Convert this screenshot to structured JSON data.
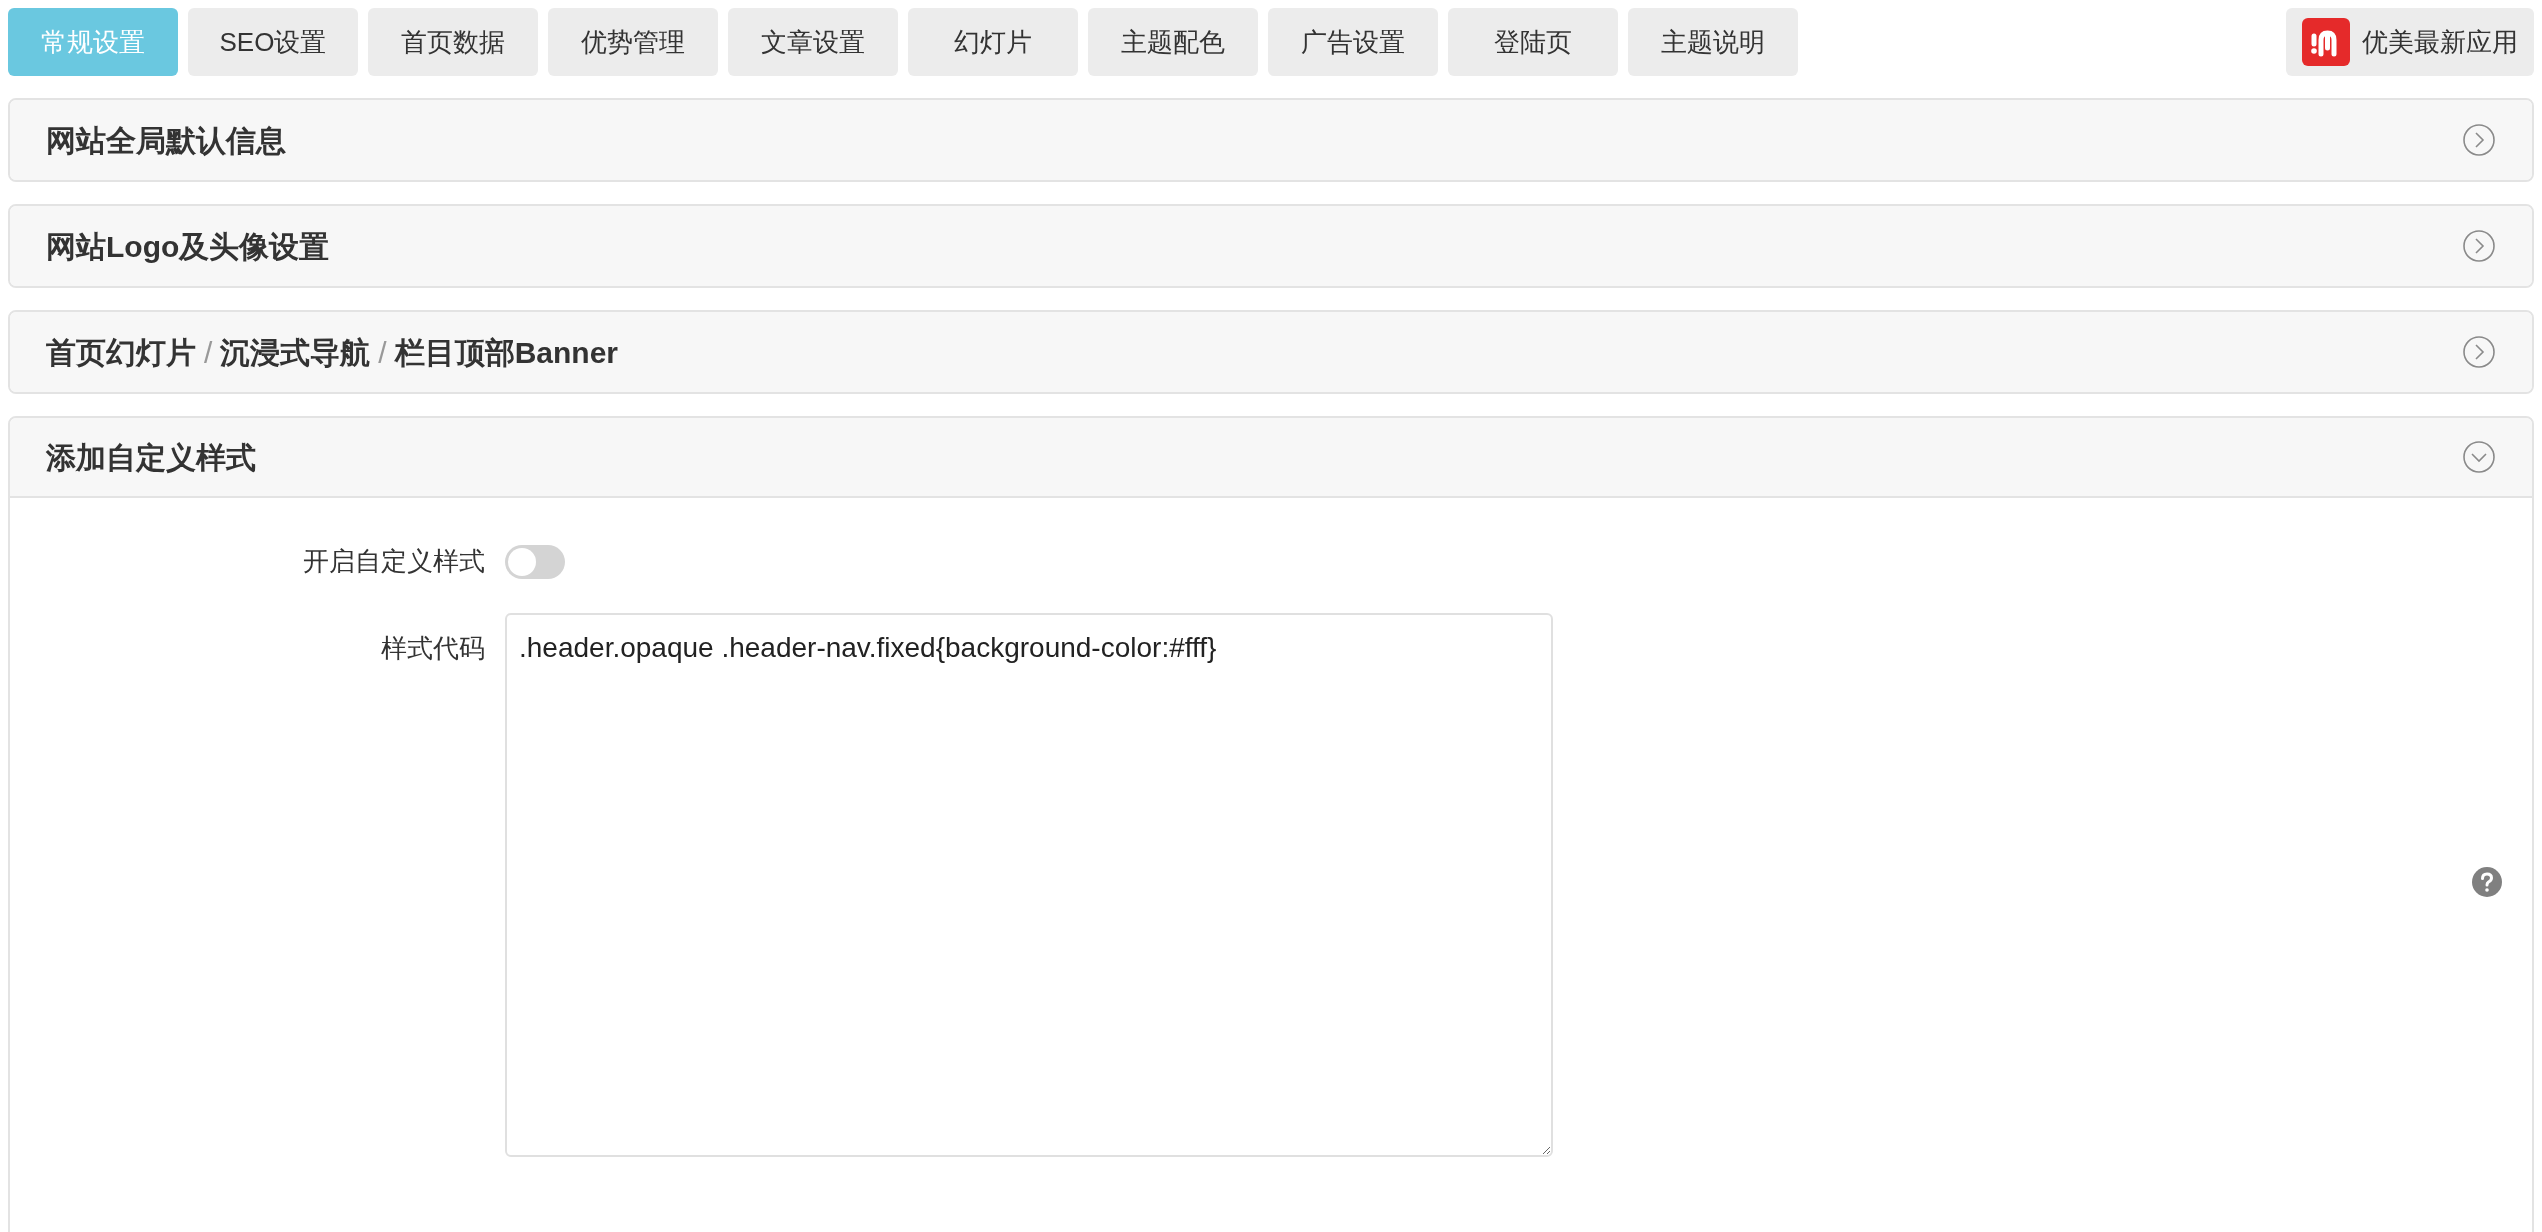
{
  "tabs": [
    {
      "label": "常规设置",
      "selected": true
    },
    {
      "label": "SEO设置",
      "selected": false
    },
    {
      "label": "首页数据",
      "selected": false
    },
    {
      "label": "优势管理",
      "selected": false
    },
    {
      "label": "文章设置",
      "selected": false
    },
    {
      "label": "幻灯片",
      "selected": false
    },
    {
      "label": "主题配色",
      "selected": false
    },
    {
      "label": "广告设置",
      "selected": false
    },
    {
      "label": "登陆页",
      "selected": false
    },
    {
      "label": "主题说明",
      "selected": false
    }
  ],
  "app_button": {
    "label": "优美最新应用"
  },
  "sections": [
    {
      "title": [
        {
          "kind": "text",
          "text": "网站全局默认信息"
        }
      ],
      "expanded": false
    },
    {
      "title": [
        {
          "kind": "text",
          "text": "网站Logo及头像设置"
        }
      ],
      "expanded": false
    },
    {
      "title": [
        {
          "kind": "text",
          "text": "首页幻灯片"
        },
        {
          "kind": "separator",
          "text": "/"
        },
        {
          "kind": "text",
          "text": "沉浸式导航"
        },
        {
          "kind": "separator",
          "text": "/"
        },
        {
          "kind": "text",
          "text": "栏目顶部Banner"
        }
      ],
      "expanded": false
    },
    {
      "title": [
        {
          "kind": "text",
          "text": "添加自定义样式"
        }
      ],
      "expanded": true,
      "fields": [
        {
          "kind": "switch",
          "label": "开启自定义样式",
          "on": false
        },
        {
          "kind": "textarea",
          "label": "样式代码",
          "value": ".header.opaque .header-nav.fixed{background-color:#fff}"
        }
      ]
    }
  ]
}
